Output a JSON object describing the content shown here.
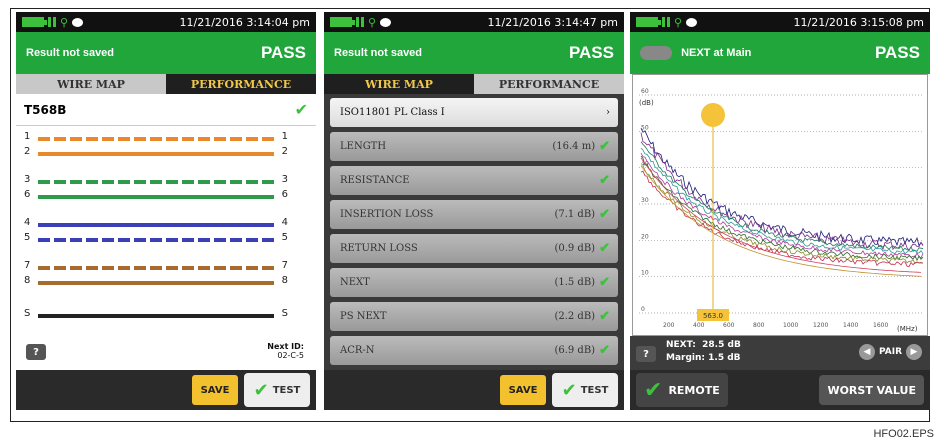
{
  "screens": {
    "wiremap": {
      "time": "11/21/2016 3:14:04 pm",
      "header_left": "Result not saved",
      "header_right": "PASS",
      "tab_left": "WIRE MAP",
      "tab_right": "PERFORMANCE",
      "standard": "T568B",
      "pins": [
        {
          "left": "1",
          "right": "1",
          "color": "#e8892d",
          "striped": true
        },
        {
          "left": "2",
          "right": "2",
          "color": "#e8892d",
          "striped": false
        },
        {
          "left": "3",
          "right": "3",
          "color": "#2e9a4a",
          "striped": true
        },
        {
          "left": "6",
          "right": "6",
          "color": "#2e9a4a",
          "striped": false
        },
        {
          "left": "4",
          "right": "4",
          "color": "#3b3fb8",
          "striped": false
        },
        {
          "left": "5",
          "right": "5",
          "color": "#3b3fb8",
          "striped": true
        },
        {
          "left": "7",
          "right": "7",
          "color": "#a86b2e",
          "striped": true
        },
        {
          "left": "8",
          "right": "8",
          "color": "#a86b2e",
          "striped": false
        },
        {
          "left": "S",
          "right": "S",
          "color": "#222222",
          "striped": false
        }
      ],
      "help": "?",
      "next_id_label": "Next ID:",
      "next_id_value": "02-C-5",
      "save": "SAVE",
      "test": "TEST"
    },
    "performance": {
      "time": "11/21/2016 3:14:47 pm",
      "header_left": "Result not saved",
      "header_right": "PASS",
      "tab_left": "WIRE MAP",
      "tab_right": "PERFORMANCE",
      "limit": "ISO11801 PL Class I",
      "rows": [
        {
          "label": "LENGTH",
          "value": "(16.4 m)"
        },
        {
          "label": "RESISTANCE",
          "value": ""
        },
        {
          "label": "INSERTION LOSS",
          "value": "(7.1 dB)"
        },
        {
          "label": "RETURN LOSS",
          "value": "(0.9 dB)"
        },
        {
          "label": "NEXT",
          "value": "(1.5 dB)"
        },
        {
          "label": "PS NEXT",
          "value": "(2.2 dB)"
        },
        {
          "label": "ACR-N",
          "value": "(6.9 dB)"
        }
      ],
      "save": "SAVE",
      "test": "TEST"
    },
    "next_chart": {
      "time": "11/21/2016 3:15:08 pm",
      "header_left": "NEXT at Main",
      "header_right": "PASS",
      "unit_y": "(dB)",
      "unit_x": "(MHz)",
      "cursor_value": "563.0",
      "y_ticks": [
        "60",
        "50",
        "40",
        "30",
        "20",
        "10",
        "0"
      ],
      "x_ticks": [
        "200",
        "400",
        "600",
        "800",
        "1000",
        "1200",
        "1400",
        "1600"
      ],
      "next_label": "NEXT:",
      "next_value": "28.5 dB",
      "margin_label": "Margin:",
      "margin_value": "1.5 dB",
      "pair_label": "PAIR",
      "help": "?",
      "remote": "REMOTE",
      "worst": "WORST VALUE"
    }
  },
  "caption": "HFO02.EPS",
  "colors": {
    "header_green": "#21a63c",
    "check_green": "#3dc13d",
    "save_yellow": "#f3c02e"
  }
}
